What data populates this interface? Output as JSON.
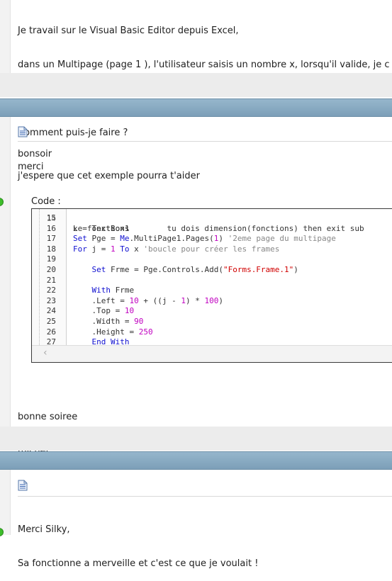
{
  "post1": {
    "lines": [
      "Je travail sur le Visual Basic Editor depuis Excel,",
      "dans un Multipage (page 1 ), l'utilisateur saisis un nombre x, lorsqu'il valide, je c",
      "",
      "Comment puis-je faire ?",
      "merci"
    ]
  },
  "post2": {
    "greeting": "bonsoir",
    "intro": "j'espere que cet exemple pourra t'aider",
    "code_label": "Code :",
    "code_partial_top": "Le fonctions        tu dois dimension(fonctions) then exit sub",
    "code": [
      {
        "n": "15",
        "text": ""
      },
      {
        "n": "16",
        "text": "x = TextBox1"
      },
      {
        "n": "17",
        "text": "Set Pge = Me.MultiPage1.Pages(1) '2eme page du multipage"
      },
      {
        "n": "18",
        "text": "For j = 1 To x 'boucle pour créer les frames"
      },
      {
        "n": "19",
        "text": ""
      },
      {
        "n": "20",
        "text": "    Set Frme = Pge.Controls.Add(\"Forms.Frame.1\")"
      },
      {
        "n": "21",
        "text": ""
      },
      {
        "n": "22",
        "text": "    With Frme"
      },
      {
        "n": "23",
        "text": "    .Left = 10 + ((j - 1) * 100)"
      },
      {
        "n": "24",
        "text": "    .Top = 10"
      },
      {
        "n": "25",
        "text": "    .Width = 90"
      },
      {
        "n": "26",
        "text": "    .Height = 250"
      },
      {
        "n": "27",
        "text": "    End With"
      }
    ],
    "closing": [
      "bonne soiree",
      "michel"
    ]
  },
  "post3": {
    "lines": [
      "Merci Silky,",
      "Sa fonctionne a merveille et c'est ce que je voulait !"
    ]
  },
  "colors": {
    "keyword": "#1010d0",
    "number": "#c000c0",
    "string": "#d00000",
    "comment": "#888888",
    "header_bar": "#7c9fb8",
    "online": "#3dbd2a"
  },
  "icons": [
    "post-icon",
    "online-status-icon",
    "scroll-left-icon"
  ]
}
